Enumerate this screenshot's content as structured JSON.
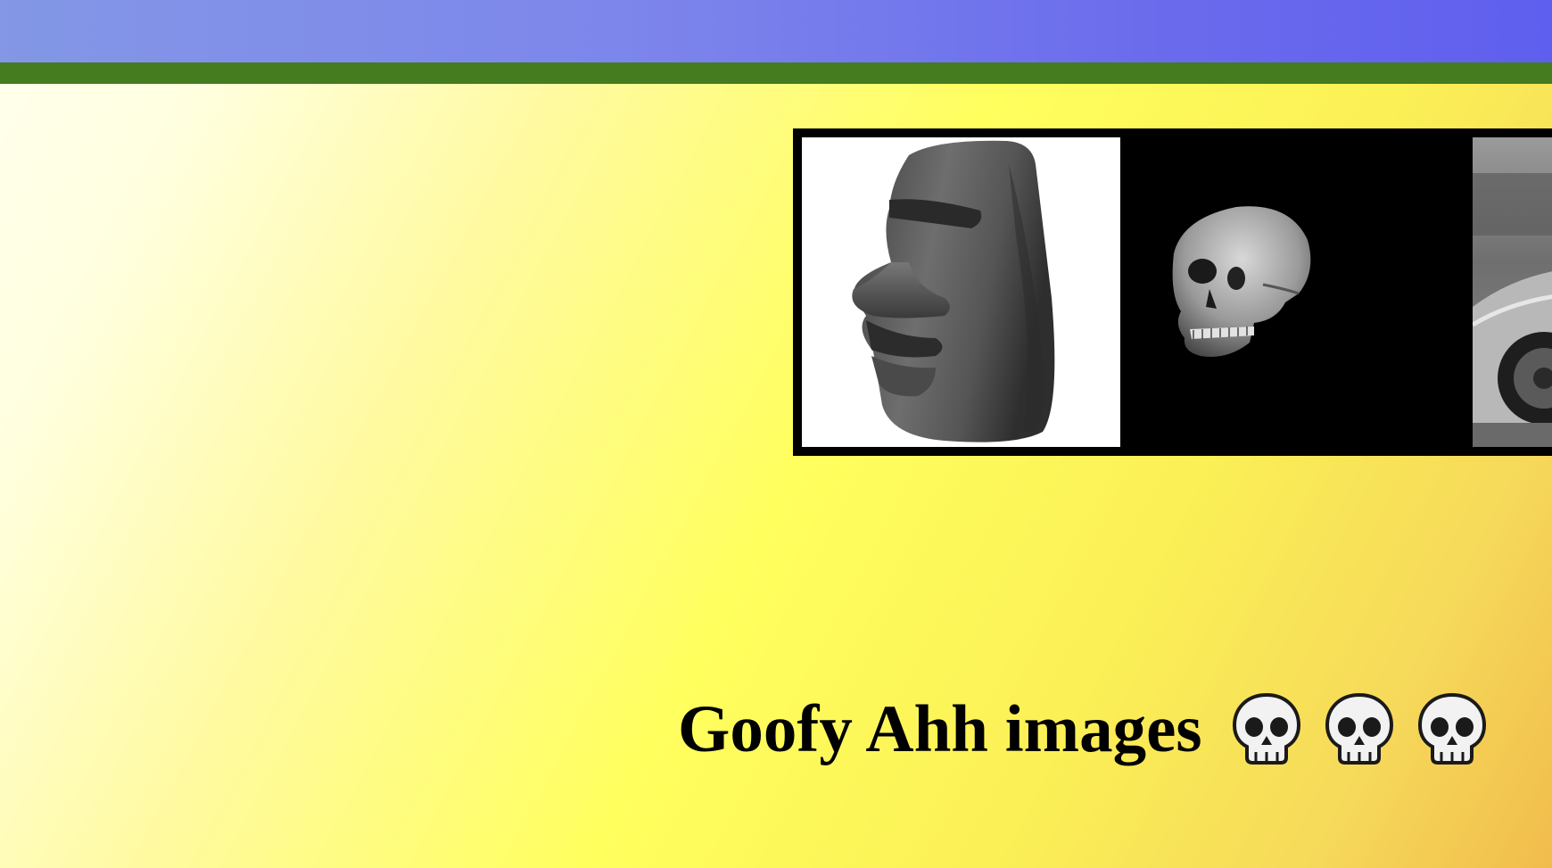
{
  "header": {
    "colors": {
      "top_bar_start": "#8397e6",
      "top_bar_end": "#5f5fef",
      "stripe": "#447c1f"
    }
  },
  "gallery": {
    "images": [
      {
        "icon": "moai-head-icon"
      },
      {
        "icon": "skull-3d-icon"
      },
      {
        "icon": "car-photo-icon"
      }
    ]
  },
  "caption": {
    "text": "Goofy Ahh images",
    "emoji_icons": [
      "skull-emoji-icon",
      "skull-emoji-icon",
      "skull-emoji-icon"
    ]
  }
}
